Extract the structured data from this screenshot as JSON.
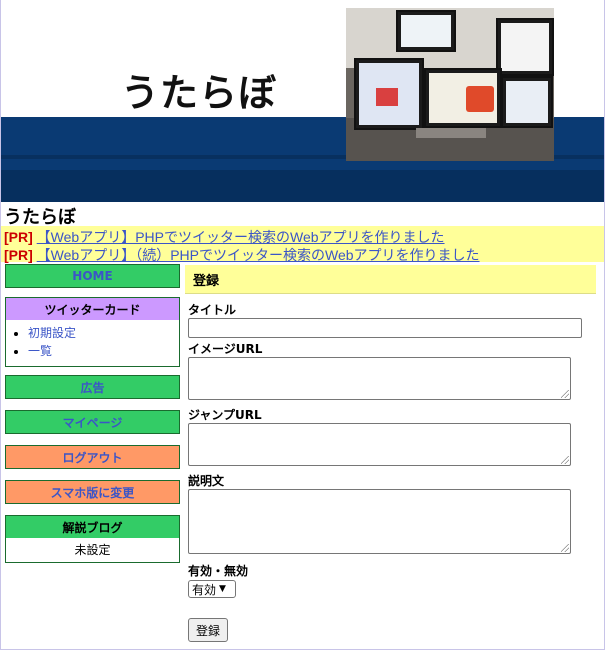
{
  "header": {
    "logo_text": "うたらぼ"
  },
  "site": {
    "title": "うたらぼ"
  },
  "pr": [
    {
      "tag": "[PR]",
      "link": "【Webアプリ】PHPでツイッター検索のWebアプリを作りました"
    },
    {
      "tag": "[PR]",
      "link": "【Webアプリ】（続）PHPでツイッター検索のWebアプリを作りました"
    }
  ],
  "sidebar": {
    "home": "HOME",
    "twitter_card": {
      "title": "ツイッターカード",
      "items": [
        "初期設定",
        "一覧"
      ]
    },
    "ads": "広告",
    "mypage": "マイページ",
    "logout": "ログアウト",
    "mobile": "スマホ版に変更",
    "blog": {
      "title": "解説ブログ",
      "value": "未設定"
    }
  },
  "form": {
    "heading": "登録",
    "title_label": "タイトル",
    "title_value": "",
    "image_url_label": "イメージURL",
    "image_url_value": "",
    "jump_url_label": "ジャンプURL",
    "jump_url_value": "",
    "description_label": "説明文",
    "description_value": "",
    "status_label": "有効・無効",
    "status_selected": "有効",
    "submit_label": "登録"
  },
  "colors": {
    "navy": "#0a3a73",
    "yellow": "#ffff99",
    "green": "#33cc66",
    "orange": "#ff9966",
    "purple": "#cc99ff",
    "link": "#3b55c7",
    "pr_red": "#cc0000"
  }
}
